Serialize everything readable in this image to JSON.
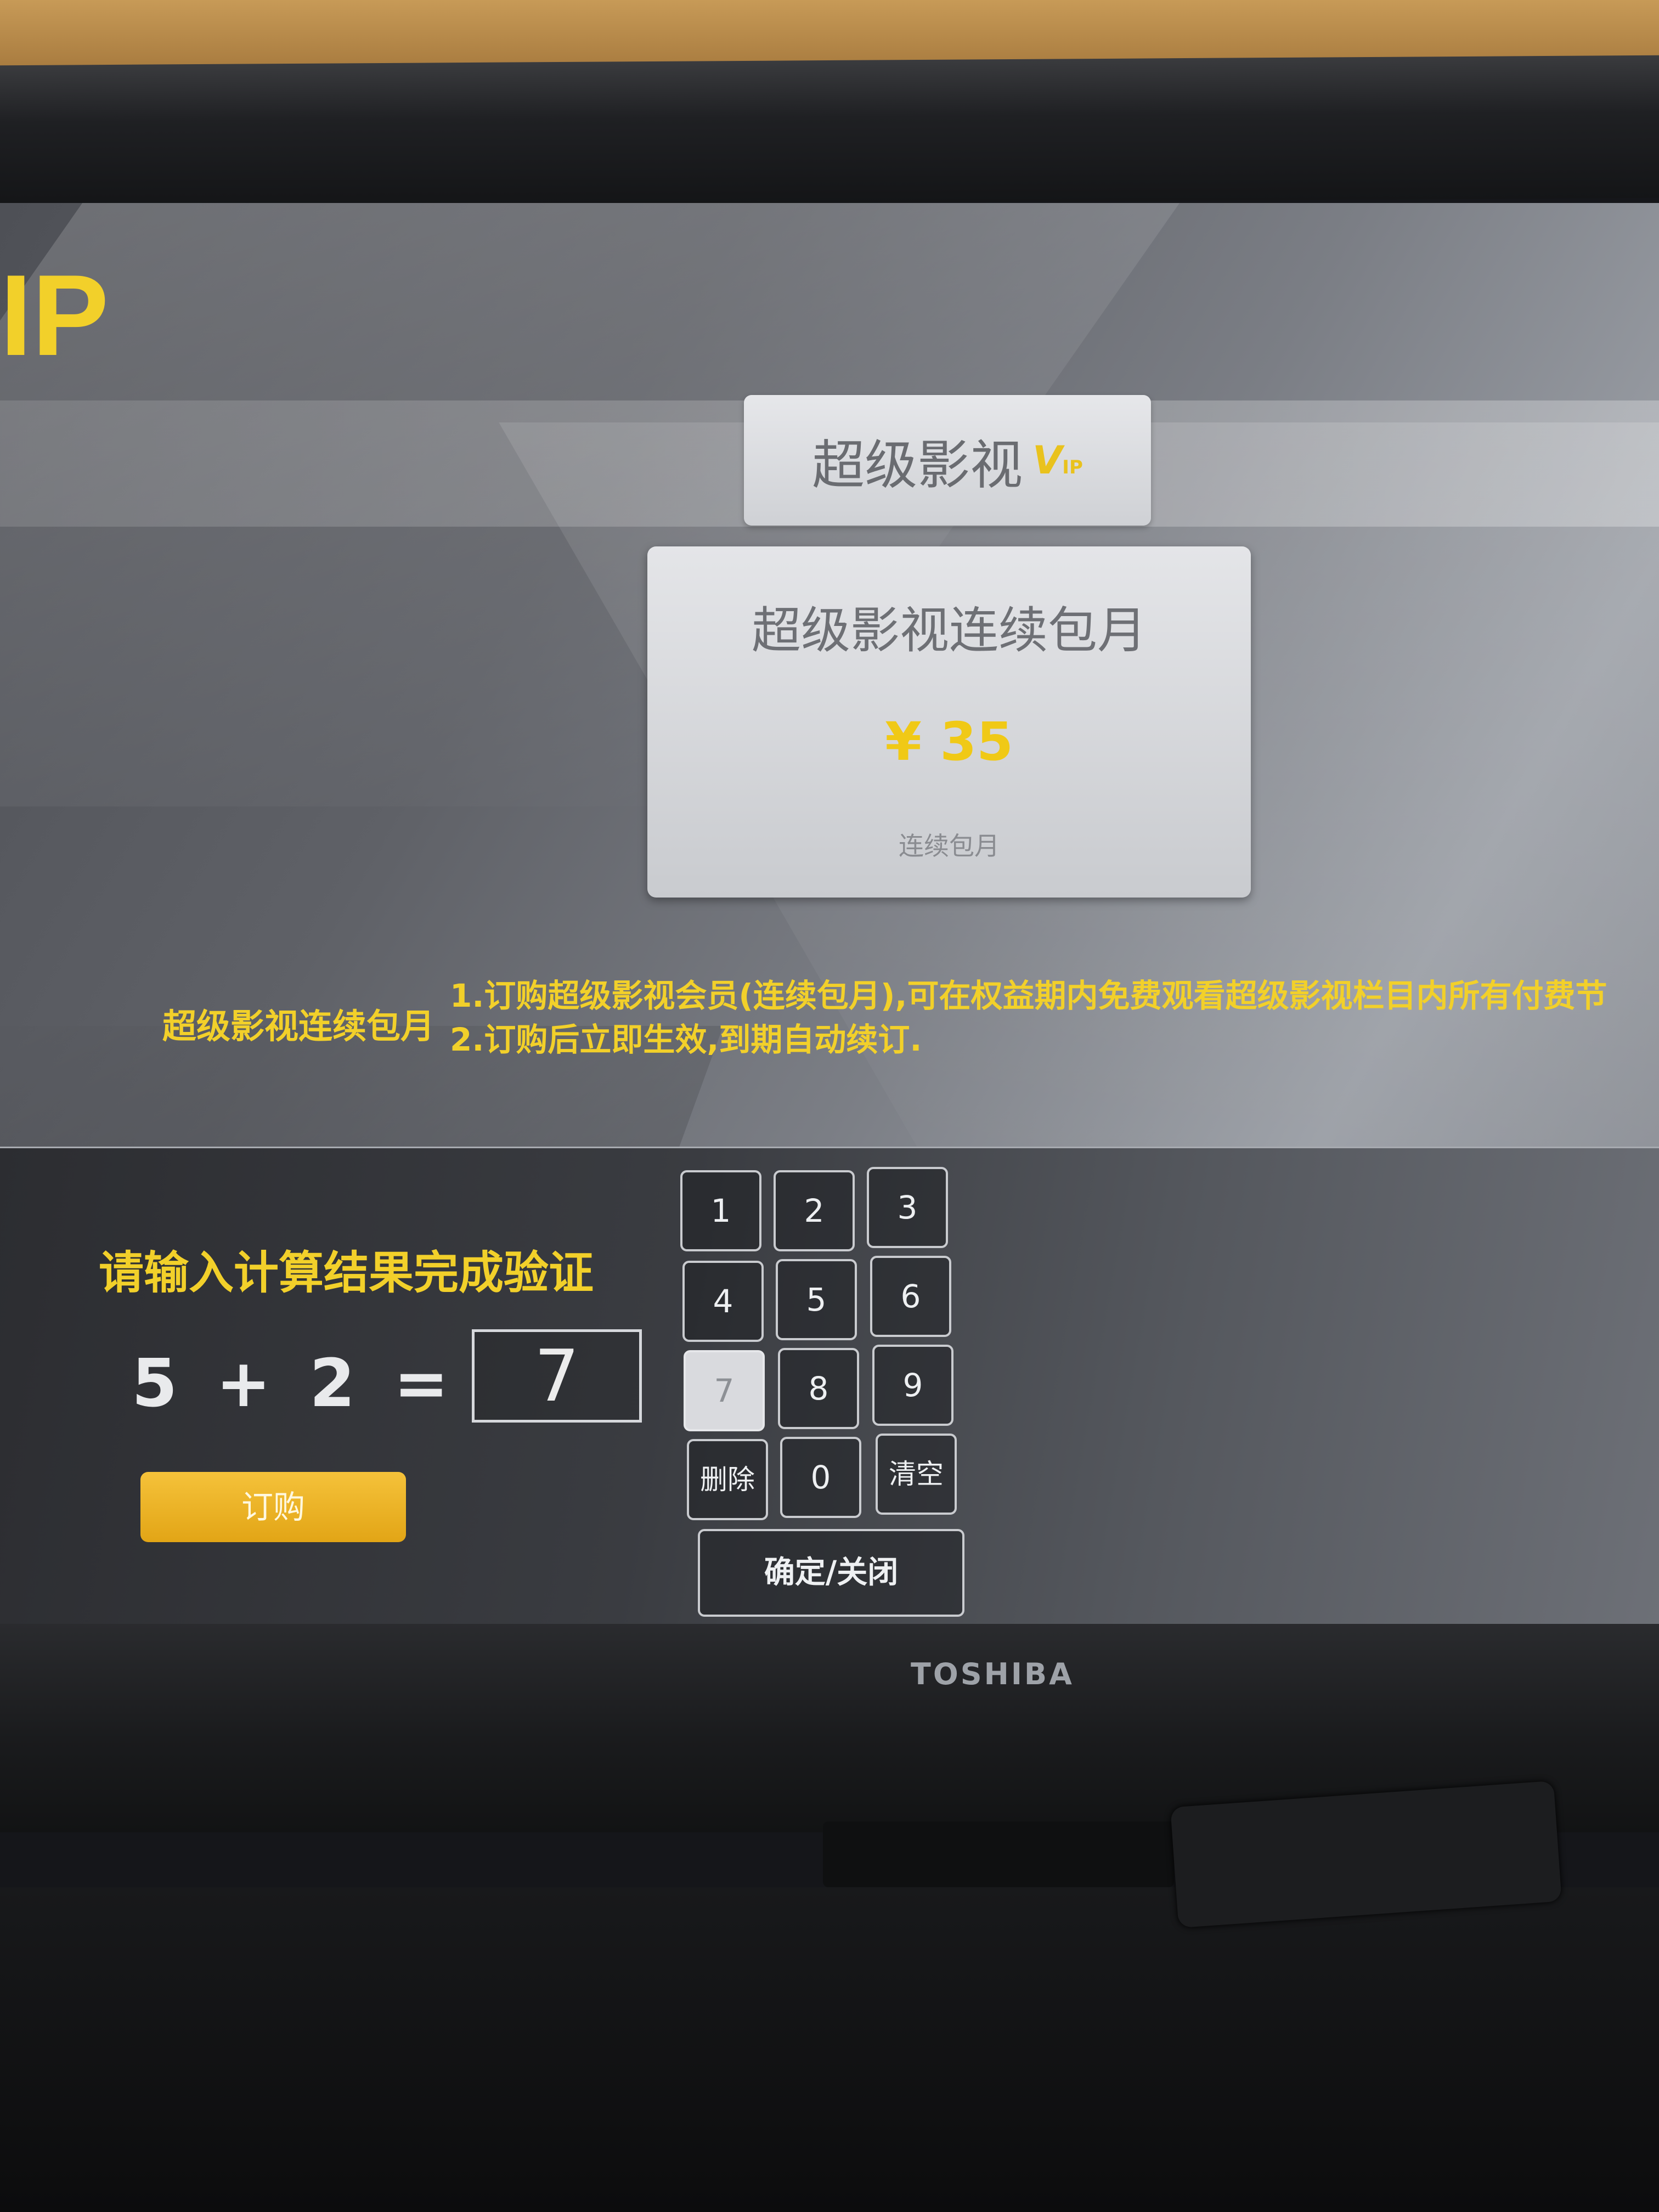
{
  "vip_edge_text": "IP",
  "product_tab": {
    "title": "超级影视",
    "badge": "V",
    "badge_small": "IP"
  },
  "package_card": {
    "title": "超级影视连续包月",
    "price": "¥ 35",
    "note": "连续包月"
  },
  "description": {
    "label": "超级影视连续包月",
    "line1": "1.订购超级影视会员(连续包月),可在权益期内免费观看超级影视栏目内所有付费节",
    "line2": "2.订购后立即生效,到期自动续订."
  },
  "verification": {
    "prompt": "请输入计算结果完成验证",
    "operand1": "5",
    "operator": "+",
    "operand2": "2",
    "equals": "=",
    "answer": "7"
  },
  "order_button": "订购",
  "keypad": {
    "k1": "1",
    "k2": "2",
    "k3": "3",
    "k4": "4",
    "k5": "5",
    "k6": "6",
    "k7": "7",
    "k8": "8",
    "k9": "9",
    "delete": "删除",
    "k0": "0",
    "clear": "清空",
    "confirm_close": "确定/关闭"
  },
  "tv_brand": "TOSHIBA",
  "colors": {
    "accent_yellow": "#f2d02a",
    "button_orange": "#e9ad1f"
  }
}
